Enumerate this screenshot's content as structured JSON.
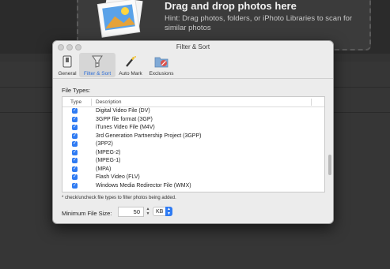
{
  "background": {
    "dropzone_title": "Drag and drop photos here",
    "dropzone_hint": "Hint: Drag photos, folders, or iPhoto Libraries to scan for similar photos"
  },
  "window": {
    "title": "Filter & Sort"
  },
  "toolbar": {
    "tabs": [
      {
        "label": "General",
        "icon": "switch-icon"
      },
      {
        "label": "Filter & Sort",
        "icon": "funnel-icon",
        "active": true
      },
      {
        "label": "Auto Mark",
        "icon": "magic-wand-icon"
      },
      {
        "label": "Exclusions",
        "icon": "folder-exclusion-icon"
      }
    ]
  },
  "file_types": {
    "label": "File Types:",
    "columns": {
      "type": "Type",
      "description": "Description"
    },
    "rows": [
      {
        "checked": true,
        "description": "Digital Video File (DV)"
      },
      {
        "checked": true,
        "description": "3GPP file format (3GP)"
      },
      {
        "checked": true,
        "description": "iTunes Video File (M4V)"
      },
      {
        "checked": true,
        "description": "3rd Generation Partnership Project (3GPP)"
      },
      {
        "checked": true,
        "description": "(3PP2)"
      },
      {
        "checked": true,
        "description": "(MPEG-2)"
      },
      {
        "checked": true,
        "description": "(MPEG-1)"
      },
      {
        "checked": true,
        "description": "(MPA)"
      },
      {
        "checked": true,
        "description": "Flash Video (FLV)"
      },
      {
        "checked": true,
        "description": "Windows Media Redirector File (WMX)"
      }
    ],
    "note": "* check/uncheck file types to filter photos being added."
  },
  "min_file_size": {
    "label": "Minimum File Size:",
    "value": "50",
    "unit": "KB"
  },
  "colors": {
    "accent": "#2f7bf3",
    "dialog_bg": "#ececec",
    "app_bg": "#333333"
  }
}
